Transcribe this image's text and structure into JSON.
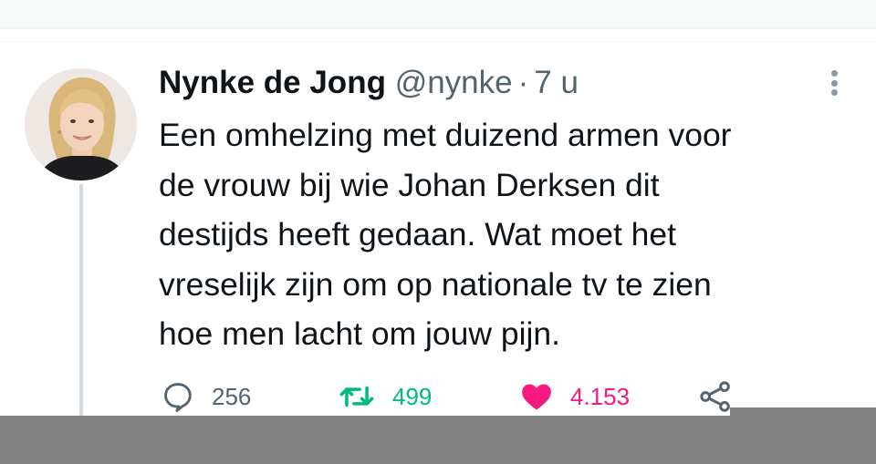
{
  "tweet": {
    "author_name": "Nynke de Jong",
    "handle": "@nynke",
    "separator": "·",
    "time": "7 u",
    "lines": [
      "Een omhelzing met duizend armen voor",
      "de vrouw bij wie Johan Derksen dit",
      "destijds heeft gedaan. Wat moet het",
      "vreselijk zijn om op nationale tv te zien",
      "hoe men lacht om jouw pijn."
    ],
    "actions": {
      "reply_count": "256",
      "retweet_count": "499",
      "like_count": "4.153"
    }
  },
  "icons": {
    "more": "more-vertical-icon",
    "reply": "reply-bubble-icon",
    "retweet": "retweet-icon",
    "like": "heart-icon",
    "share": "share-icon"
  },
  "colors": {
    "retweet": "#00ba7c",
    "like": "#f91880",
    "secondary_text": "#536471"
  }
}
